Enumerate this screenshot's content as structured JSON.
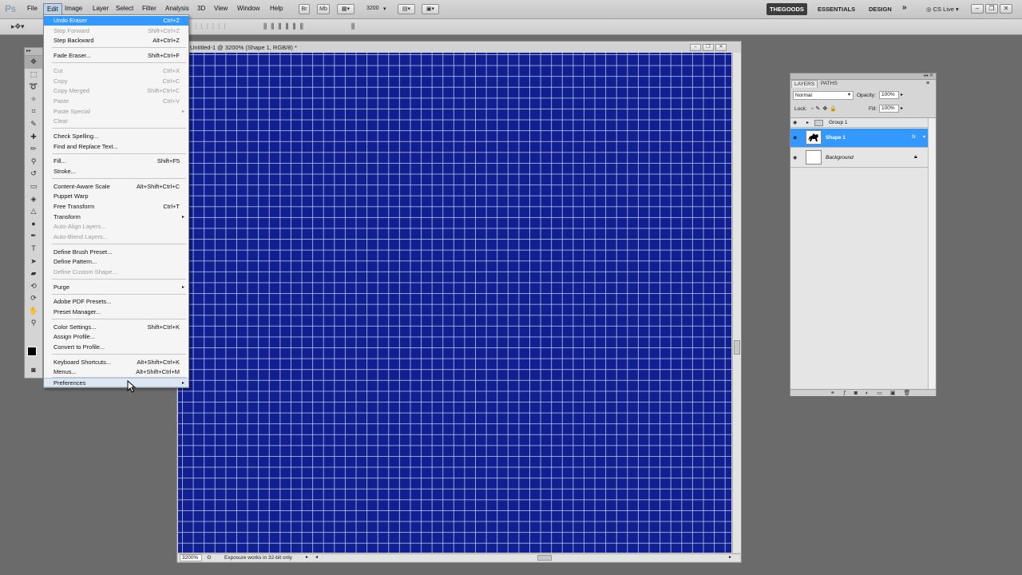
{
  "app": {
    "logo": "Ps"
  },
  "menubar": {
    "items": [
      "File",
      "Edit",
      "Image",
      "Layer",
      "Select",
      "Filter",
      "Analysis",
      "3D",
      "View",
      "Window",
      "Help"
    ],
    "zoom_value": "3200",
    "workspaces": {
      "active": "THEGOODS",
      "others": [
        "ESSENTIALS",
        "DESIGN"
      ],
      "more": "»"
    },
    "cs_live": "CS Live",
    "window_controls": [
      "‒",
      "❐",
      "✕"
    ]
  },
  "edit_menu": {
    "items": [
      {
        "label": "Undo Eraser",
        "shortcut": "Ctrl+Z",
        "state": "highlighted"
      },
      {
        "label": "Step Forward",
        "shortcut": "Shift+Ctrl+Z",
        "state": "disabled"
      },
      {
        "label": "Step Backward",
        "shortcut": "Alt+Ctrl+Z",
        "state": "normal"
      },
      {
        "label": "Fade Eraser...",
        "shortcut": "Shift+Ctrl+F",
        "state": "normal"
      },
      {
        "label": "Cut",
        "shortcut": "Ctrl+X",
        "state": "disabled"
      },
      {
        "label": "Copy",
        "shortcut": "Ctrl+C",
        "state": "disabled"
      },
      {
        "label": "Copy Merged",
        "shortcut": "Shift+Ctrl+C",
        "state": "disabled"
      },
      {
        "label": "Paste",
        "shortcut": "Ctrl+V",
        "state": "disabled"
      },
      {
        "label": "Paste Special",
        "shortcut": "",
        "submenu": true,
        "state": "disabled"
      },
      {
        "label": "Clear",
        "shortcut": "",
        "state": "disabled"
      },
      {
        "label": "Check Spelling...",
        "shortcut": "",
        "state": "normal"
      },
      {
        "label": "Find and Replace Text...",
        "shortcut": "",
        "state": "normal"
      },
      {
        "label": "Fill...",
        "shortcut": "Shift+F5",
        "state": "normal"
      },
      {
        "label": "Stroke...",
        "shortcut": "",
        "state": "normal"
      },
      {
        "label": "Content-Aware Scale",
        "shortcut": "Alt+Shift+Ctrl+C",
        "state": "normal"
      },
      {
        "label": "Puppet Warp",
        "shortcut": "",
        "state": "normal"
      },
      {
        "label": "Free Transform",
        "shortcut": "Ctrl+T",
        "state": "normal"
      },
      {
        "label": "Transform",
        "shortcut": "",
        "submenu": true,
        "state": "normal"
      },
      {
        "label": "Auto-Align Layers...",
        "shortcut": "",
        "state": "disabled"
      },
      {
        "label": "Auto-Blend Layers...",
        "shortcut": "",
        "state": "disabled"
      },
      {
        "label": "Define Brush Preset...",
        "shortcut": "",
        "state": "normal"
      },
      {
        "label": "Define Pattern...",
        "shortcut": "",
        "state": "normal"
      },
      {
        "label": "Define Custom Shape...",
        "shortcut": "",
        "state": "disabled"
      },
      {
        "label": "Purge",
        "shortcut": "",
        "submenu": true,
        "state": "normal"
      },
      {
        "label": "Adobe PDF Presets...",
        "shortcut": "",
        "state": "normal"
      },
      {
        "label": "Preset Manager...",
        "shortcut": "",
        "state": "normal"
      },
      {
        "label": "Color Settings...",
        "shortcut": "Shift+Ctrl+K",
        "state": "normal"
      },
      {
        "label": "Assign Profile...",
        "shortcut": "",
        "state": "normal"
      },
      {
        "label": "Convert to Profile...",
        "shortcut": "",
        "state": "normal"
      },
      {
        "label": "Keyboard Shortcuts...",
        "shortcut": "Alt+Shift+Ctrl+K",
        "state": "normal"
      },
      {
        "label": "Menus...",
        "shortcut": "Alt+Shift+Ctrl+M",
        "state": "normal"
      },
      {
        "label": "Preferences",
        "shortcut": "",
        "submenu": true,
        "state": "hover"
      }
    ]
  },
  "document": {
    "title": "Untitled-1 @ 3200% (Shape 1, RGB/8) *",
    "zoom": "3200%",
    "status": "Exposure works in 32-bit only",
    "canvas_color": "#121f90",
    "grid_color": "#b9c8f0"
  },
  "layers_panel": {
    "tabs": [
      "LAYERS",
      "PATHS"
    ],
    "blend_mode": "Normal",
    "opacity_label": "Opacity:",
    "opacity_value": "100%",
    "lock_label": "Lock:",
    "fill_label": "Fill:",
    "fill_value": "100%",
    "layers": [
      {
        "name": "Group 1",
        "type": "group",
        "selected": false
      },
      {
        "name": "Shape 1",
        "type": "shape",
        "selected": true,
        "fx": "fx"
      },
      {
        "name": "Background",
        "type": "background",
        "selected": false
      }
    ]
  },
  "colors": {
    "accent": "#3399ff",
    "foreground": "#000000",
    "background": "#ffffff"
  }
}
